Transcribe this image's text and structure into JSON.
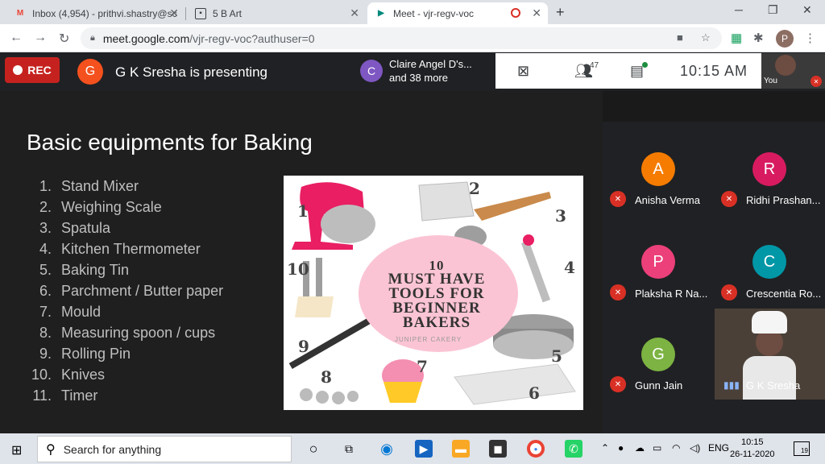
{
  "browser": {
    "tabs": [
      {
        "title": "Inbox (4,954) - prithvi.shastry@sc",
        "icon": "gmail-icon",
        "color": "#ea4335"
      },
      {
        "title": "5 B Art",
        "icon": "classroom-icon",
        "color": "#3c4043"
      },
      {
        "title": "Meet - vjr-regv-voc",
        "icon": "meet-icon",
        "color": "#00897b"
      }
    ],
    "url_host": "meet.google.com",
    "url_path": "/vjr-regv-voc?authuser=0",
    "profile_initial": "P"
  },
  "meet": {
    "rec_label": "REC",
    "presenter_initial": "G",
    "presenter_text": "G K Sresha is presenting",
    "chat_initial": "C",
    "chat_line1": "Claire Angel D's...",
    "chat_line2": "and 38 more",
    "participant_count": "47",
    "time": "10:15  AM",
    "you_label": "You"
  },
  "slide": {
    "title": "Basic equipments for Baking",
    "items": [
      {
        "n": "1.",
        "t": "Stand Mixer"
      },
      {
        "n": "2.",
        "t": "Weighing Scale"
      },
      {
        "n": "3.",
        "t": "Spatula"
      },
      {
        "n": "4.",
        "t": "Kitchen Thermometer"
      },
      {
        "n": "5.",
        "t": "Baking Tin"
      },
      {
        "n": "6.",
        "t": "Parchment / Butter paper"
      },
      {
        "n": "7.",
        "t": "Mould"
      },
      {
        "n": "8.",
        "t": "Measuring spoon / cups"
      },
      {
        "n": "9.",
        "t": "Rolling Pin"
      },
      {
        "n": "10.",
        "t": "Knives"
      },
      {
        "n": "11.",
        "t": "Timer"
      }
    ],
    "poster": {
      "line1": "10",
      "line2": "MUST HAVE",
      "line3": "TOOLS FOR",
      "line4": "BEGINNER",
      "line5": "BAKERS",
      "caption": "JUNIPER CAKERY",
      "numbers": [
        "1",
        "2",
        "3",
        "4",
        "5",
        "6",
        "7",
        "8",
        "9",
        "10"
      ]
    }
  },
  "participants": [
    {
      "initial": "A",
      "name": "Anisha Verma",
      "color": "#f57c00"
    },
    {
      "initial": "R",
      "name": "Ridhi Prashan...",
      "color": "#d81b60"
    },
    {
      "initial": "P",
      "name": "Plaksha R Na...",
      "color": "#ec407a"
    },
    {
      "initial": "C",
      "name": "Crescentia Ro...",
      "color": "#0097a7"
    },
    {
      "initial": "G",
      "name": "Gunn Jain",
      "color": "#7cb342"
    },
    {
      "initial": "",
      "name": "G K Sresha",
      "color": "#4a4038"
    }
  ],
  "taskbar": {
    "search_placeholder": "Search for anything",
    "lang": "ENG",
    "clock_time": "10:15",
    "clock_date": "26-11-2020",
    "notif_count": "19"
  }
}
